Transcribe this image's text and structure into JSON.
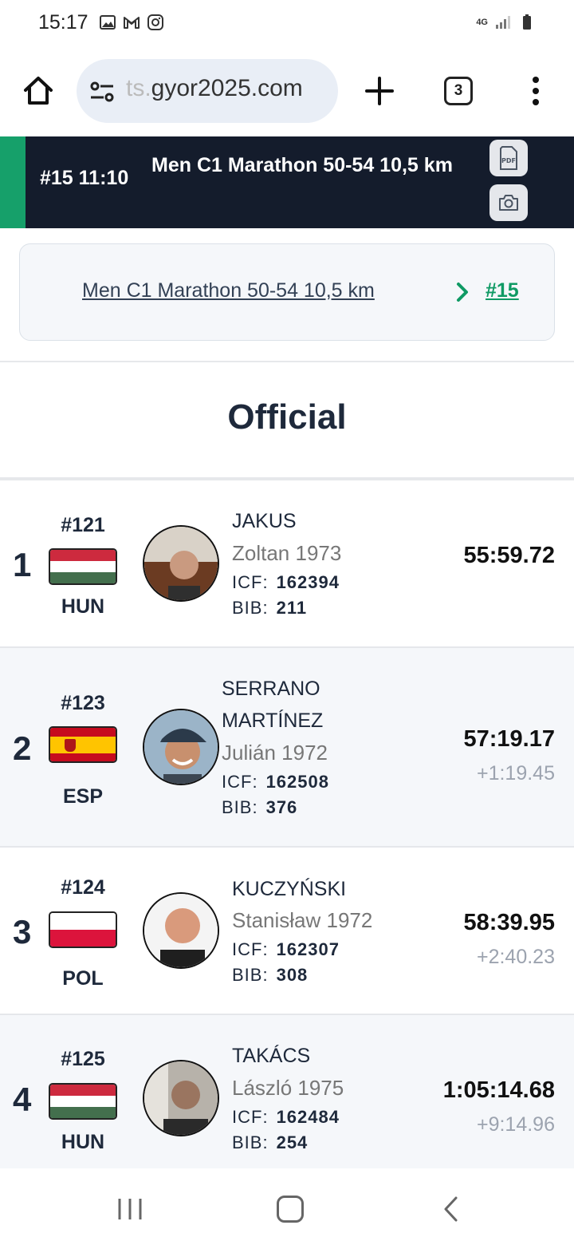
{
  "status": {
    "time": "15:17",
    "network": "4G"
  },
  "browser": {
    "url_faded": "ts.",
    "url_main": "gyor2025.com",
    "tab_count": "3"
  },
  "event": {
    "number_time": "#15 11:10",
    "title": "Men C1 Marathon 50-54 10,5 km",
    "accent_color": "#16a06a"
  },
  "breadcrumb": {
    "event_link": "Men C1 Marathon 50-54 10,5 km",
    "event_num": "#15"
  },
  "section_title": "Official",
  "results": [
    {
      "rank": "1",
      "seed": "#121",
      "country": "HUN",
      "last_name": "JAKUS",
      "first_name_year": "Zoltan 1973",
      "icf_label": "ICF:",
      "icf": "162394",
      "bib_label": "BIB:",
      "bib": "211",
      "time": "55:59.72",
      "gap": ""
    },
    {
      "rank": "2",
      "seed": "#123",
      "country": "ESP",
      "last_name_1": "SERRANO",
      "last_name_2": "MARTÍNEZ",
      "first_name_year": "Julián 1972",
      "icf_label": "ICF:",
      "icf": "162508",
      "bib_label": "BIB:",
      "bib": "376",
      "time": "57:19.17",
      "gap": "+1:19.45"
    },
    {
      "rank": "3",
      "seed": "#124",
      "country": "POL",
      "last_name": "KUCZYŃSKI",
      "first_name_year": "Stanisław 1972",
      "icf_label": "ICF:",
      "icf": "162307",
      "bib_label": "BIB:",
      "bib": "308",
      "time": "58:39.95",
      "gap": "+2:40.23"
    },
    {
      "rank": "4",
      "seed": "#125",
      "country": "HUN",
      "last_name": "TAKÁCS",
      "first_name_year": "László 1975",
      "icf_label": "ICF:",
      "icf": "162484",
      "bib_label": "BIB:",
      "bib": "254",
      "time": "1:05:14.68",
      "gap": "+9:14.96"
    }
  ]
}
